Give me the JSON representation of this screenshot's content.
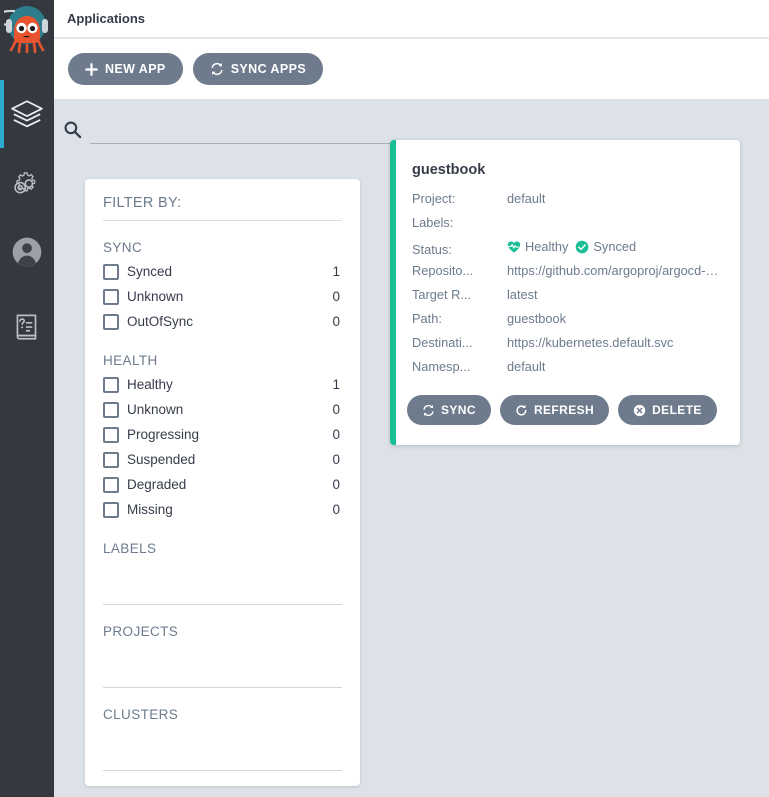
{
  "header": {
    "title": "Applications"
  },
  "sidebar": {
    "logo": "argo-octopus-logo",
    "items": [
      {
        "id": "applications",
        "icon": "layers-icon",
        "active": true
      },
      {
        "id": "settings",
        "icon": "gear-icon",
        "active": false
      },
      {
        "id": "user-info",
        "icon": "user-icon",
        "active": false
      },
      {
        "id": "documentation",
        "icon": "book-help-icon",
        "active": false
      }
    ]
  },
  "toolbar": {
    "new_app_label": "NEW APP",
    "sync_apps_label": "SYNC APPS"
  },
  "search": {
    "value": "",
    "placeholder": ""
  },
  "filters": {
    "title": "FILTER BY:",
    "groups": [
      {
        "heading": "SYNC",
        "options": [
          {
            "label": "Synced",
            "count": "1",
            "checked": false
          },
          {
            "label": "Unknown",
            "count": "0",
            "checked": false
          },
          {
            "label": "OutOfSync",
            "count": "0",
            "checked": false
          }
        ]
      },
      {
        "heading": "HEALTH",
        "options": [
          {
            "label": "Healthy",
            "count": "1",
            "checked": false
          },
          {
            "label": "Unknown",
            "count": "0",
            "checked": false
          },
          {
            "label": "Progressing",
            "count": "0",
            "checked": false
          },
          {
            "label": "Suspended",
            "count": "0",
            "checked": false
          },
          {
            "label": "Degraded",
            "count": "0",
            "checked": false
          },
          {
            "label": "Missing",
            "count": "0",
            "checked": false
          }
        ]
      }
    ],
    "labels_heading": "LABELS",
    "projects_heading": "PROJECTS",
    "clusters_heading": "CLUSTERS"
  },
  "app_card": {
    "name": "guestbook",
    "accent_color": "#18be94",
    "fields": [
      {
        "key": "Project:",
        "value": "default"
      },
      {
        "key": "Labels:",
        "value": ""
      },
      {
        "key": "Repository:",
        "key_display": "Reposito...",
        "value": "https://github.com/argoproj/argocd-exa..."
      },
      {
        "key": "Target Revision:",
        "key_display": "Target R...",
        "value": "latest"
      },
      {
        "key": "Path:",
        "key_display": "Path:",
        "value": "guestbook"
      },
      {
        "key": "Destination:",
        "key_display": "Destinati...",
        "value": "https://kubernetes.default.svc"
      },
      {
        "key": "Namespace:",
        "key_display": "Namesp...",
        "value": "default"
      }
    ],
    "status": {
      "key": "Status:",
      "health_label": "Healthy",
      "health_icon": "heart-pulse-icon",
      "health_color": "#18be94",
      "sync_label": "Synced",
      "sync_icon": "check-circle-icon",
      "sync_color": "#18be94"
    },
    "actions": [
      {
        "label": "SYNC",
        "icon": "sync-icon"
      },
      {
        "label": "REFRESH",
        "icon": "refresh-icon"
      },
      {
        "label": "DELETE",
        "icon": "delete-circle-icon"
      }
    ]
  },
  "colors": {
    "background": "#dde2e9",
    "sidebar": "#33393f",
    "sidebar_active": "#2dacd1",
    "button": "#6d7b8d",
    "text_dark": "#363c4a",
    "text_muted": "#6d7b8d",
    "green": "#18be94"
  }
}
